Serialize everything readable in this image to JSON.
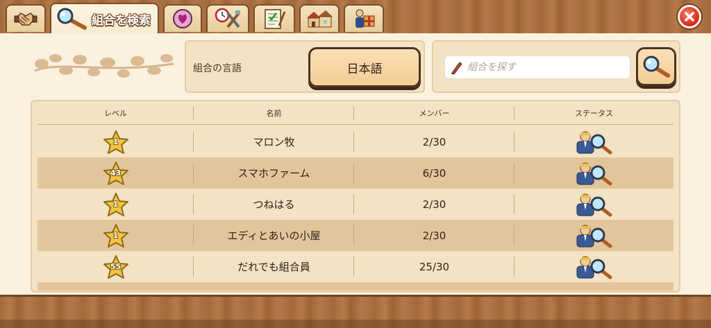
{
  "tabs": [
    {
      "icon": "handshake-icon"
    },
    {
      "icon": "magnifier-icon",
      "label": "組合を検索",
      "active": true
    },
    {
      "icon": "heart-icon"
    },
    {
      "icon": "clock-tools-icon"
    },
    {
      "icon": "notepad-icon"
    },
    {
      "icon": "houses-icon"
    },
    {
      "icon": "gift-person-icon"
    }
  ],
  "close_icon": "close-icon",
  "language": {
    "label": "組合の言語",
    "selected": "日本語"
  },
  "search": {
    "placeholder": "組合を探す",
    "button_icon": "magnifier-icon"
  },
  "table": {
    "headers": [
      "レベル",
      "名前",
      "メンバー",
      "ステータス"
    ],
    "rows": [
      {
        "level": "1",
        "name": "マロン牧",
        "members": "2/30",
        "status_icon": "member-search-icon"
      },
      {
        "level": "43",
        "name": "スマホファーム",
        "members": "6/30",
        "status_icon": "member-search-icon"
      },
      {
        "level": "1",
        "name": "つねはる",
        "members": "2/30",
        "status_icon": "member-search-icon"
      },
      {
        "level": "1",
        "name": "エディとあいの小屋",
        "members": "2/30",
        "status_icon": "member-search-icon"
      },
      {
        "level": "55",
        "name": "だれでも組合員",
        "members": "25/30",
        "status_icon": "member-search-icon"
      }
    ]
  },
  "colors": {
    "accent_star": "#f2c440",
    "row_alt": "#e3c59b",
    "panel": "#fbf1df"
  }
}
